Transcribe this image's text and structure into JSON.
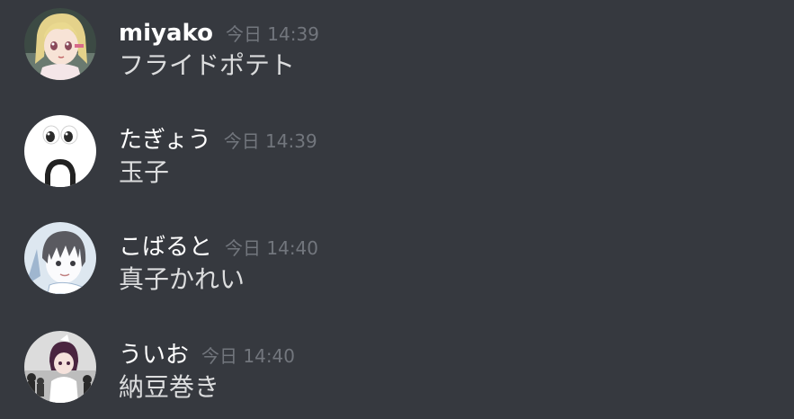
{
  "colors": {
    "background": "#36393f",
    "username": "#ffffff",
    "timestamp": "#72767d",
    "message_text": "#dcddde"
  },
  "messages": [
    {
      "username": "miyako",
      "timestamp": "今日 14:39",
      "content": "フライドポテト",
      "avatar_icon": "anime-girl-blonde-avatar"
    },
    {
      "username": "たぎょう",
      "timestamp": "今日 14:39",
      "content": "玉子",
      "avatar_icon": "googly-eyes-face-avatar"
    },
    {
      "username": "こばると",
      "timestamp": "今日 14:40",
      "content": "真子かれい",
      "avatar_icon": "anime-boy-dark-hair-avatar"
    },
    {
      "username": "ういお",
      "timestamp": "今日 14:40",
      "content": "納豆巻き",
      "avatar_icon": "anime-girl-purple-hair-avatar"
    }
  ]
}
